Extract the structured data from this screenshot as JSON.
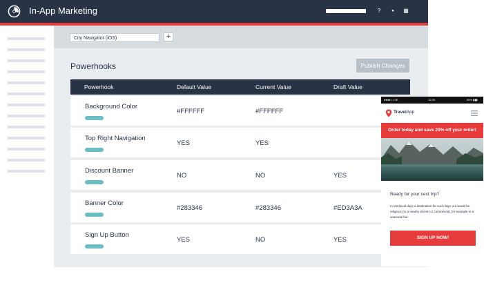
{
  "header": {
    "title": "In-App Marketing",
    "icons": [
      "help-icon",
      "user-icon",
      "apps-grid-icon"
    ],
    "help_glyph": "?",
    "user_glyph": "●",
    "apps_glyph": "▦"
  },
  "toolbar": {
    "app_select_value": "City Navigator (iOS)",
    "add_label": "+"
  },
  "section": {
    "title": "Powerhooks",
    "publish_label": "Publish Changes"
  },
  "table": {
    "columns": [
      "Powerhook",
      "Default Value",
      "Current Value",
      "Draft Value"
    ],
    "rows": [
      {
        "name": "Background Color",
        "default": "#FFFFFF",
        "current": "#FFFFFF",
        "draft": ""
      },
      {
        "name": "Top Right Navigation",
        "default": "YES",
        "current": "YES",
        "draft": ""
      },
      {
        "name": "Discount Banner",
        "default": "NO",
        "current": "NO",
        "draft": "YES"
      },
      {
        "name": "Banner Color",
        "default": "#283346",
        "current": "#283346",
        "draft": "#ED3A3A"
      },
      {
        "name": "Sign Up Button",
        "default": "YES",
        "current": "NO",
        "draft": "YES"
      }
    ]
  },
  "phone": {
    "status_left": "●●●●○ LTE",
    "status_time": "12:20",
    "status_right": "99% ▮▮▮",
    "brand_bold": "Travel",
    "brand_rest": "App",
    "promo": "Order today and save 20% off your order!",
    "ready": "Ready for your next trip?",
    "body": "In Medieval days a destination for such days out would be religious (to a nearby shrine) or commercial, for example to a seasonal fair.",
    "signup": "SIGN UP NOW!"
  },
  "colors": {
    "navy": "#283346",
    "accent_red": "#E63C3C",
    "tag_teal": "#6BBDC4",
    "main_bg": "#E9EDF0"
  }
}
